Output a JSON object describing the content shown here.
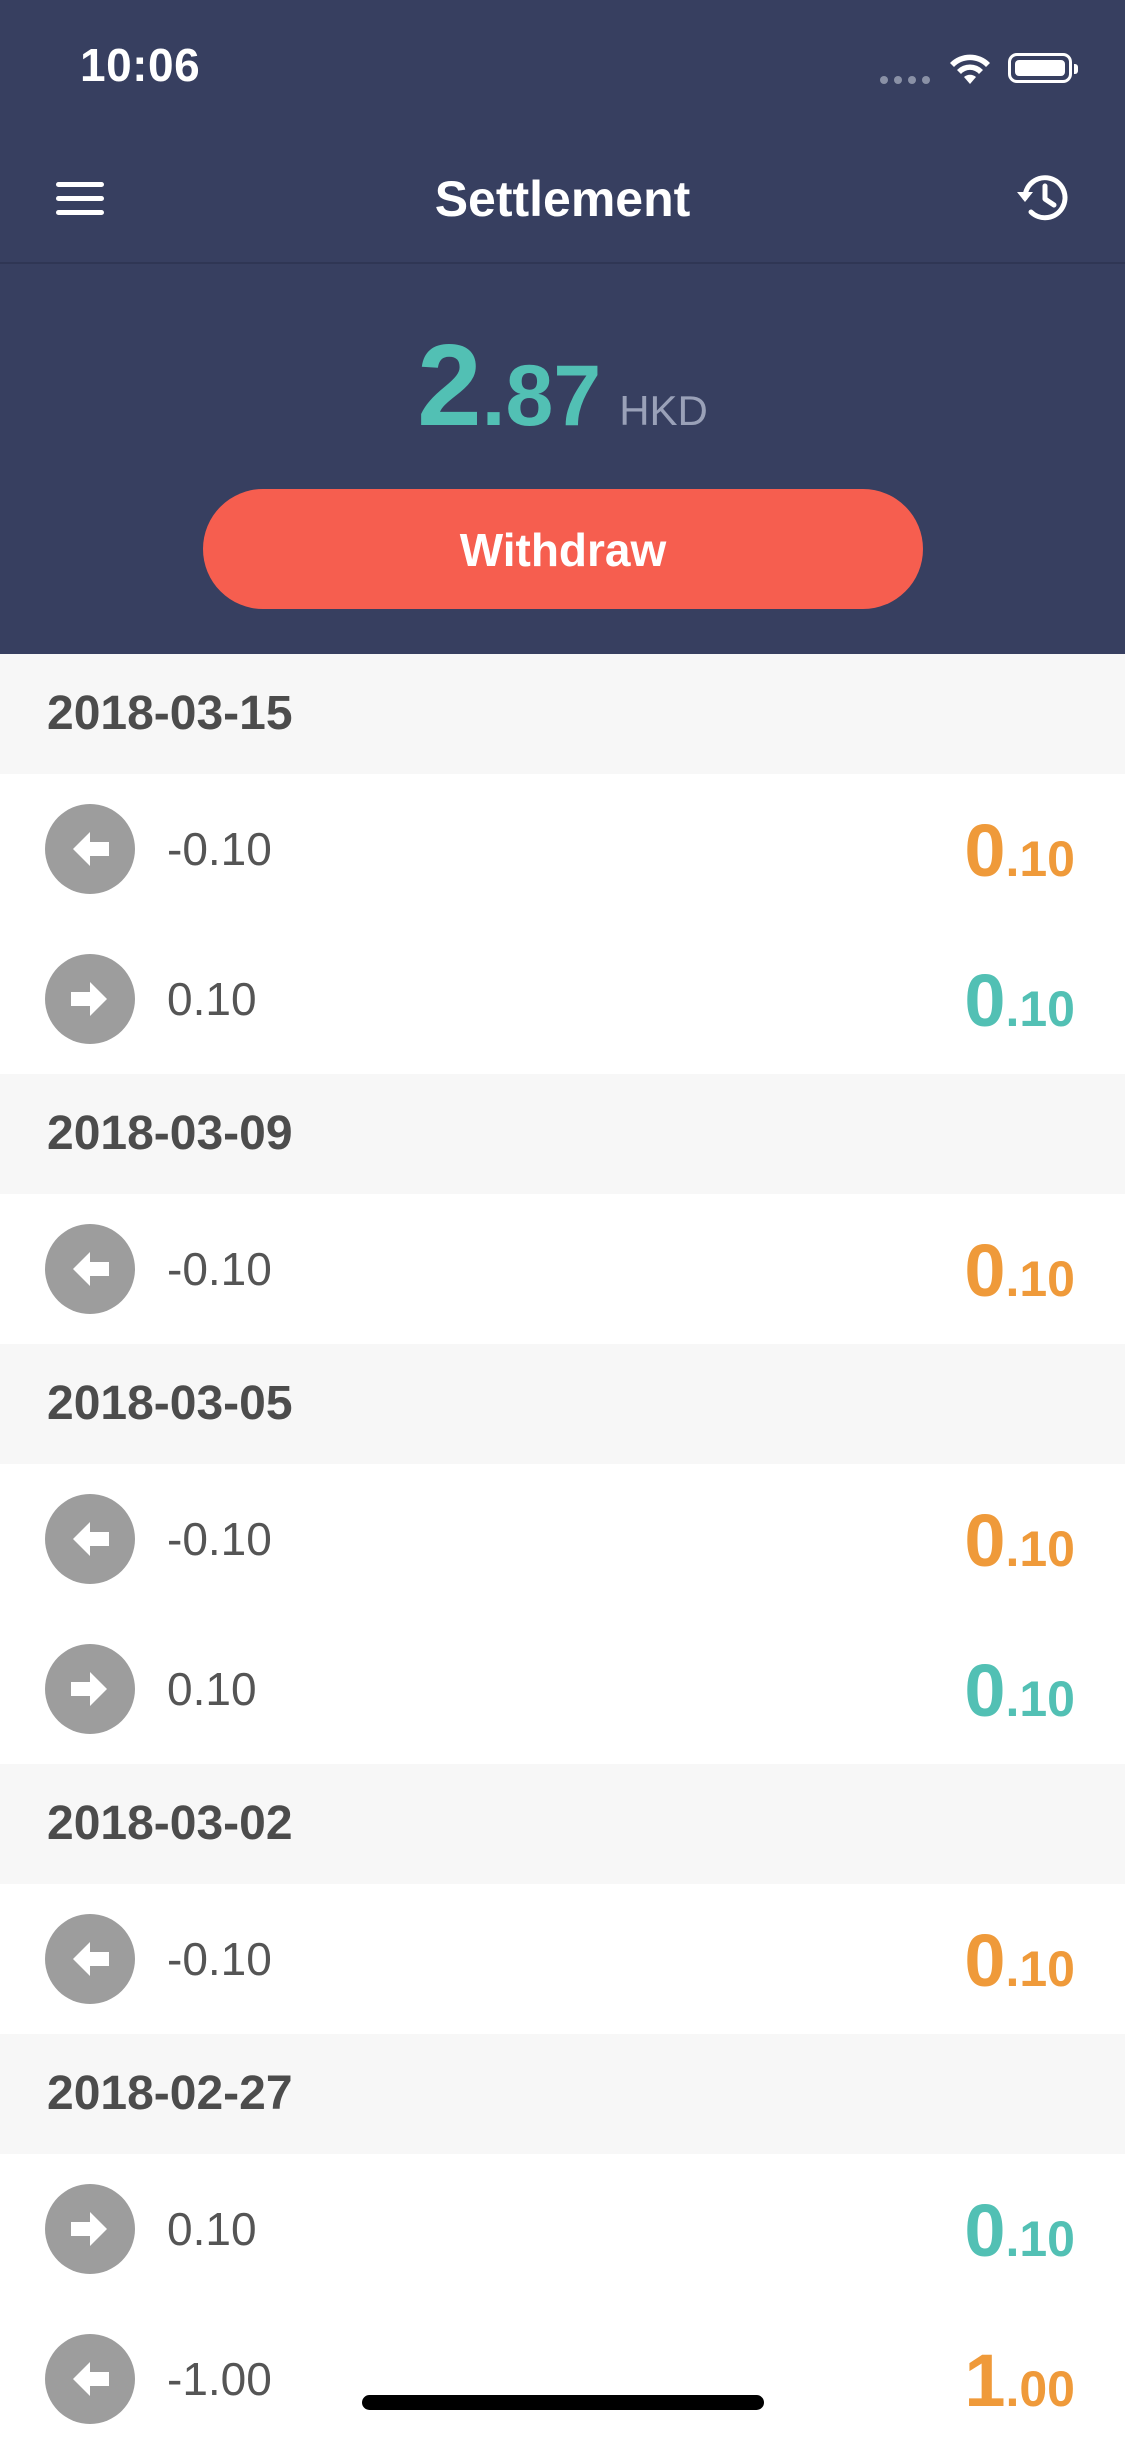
{
  "status_bar": {
    "time": "10:06"
  },
  "nav": {
    "title": "Settlement",
    "menu_icon": "hamburger-menu-icon",
    "history_icon": "history-clock-icon"
  },
  "balance": {
    "integer": "2",
    "decimal": ".87",
    "currency": "HKD"
  },
  "withdraw": {
    "label": "Withdraw"
  },
  "colors": {
    "header_bg": "#373f60",
    "accent_teal": "#52c0b4",
    "accent_orange": "#ef9a3a",
    "button_red": "#f65e4f"
  },
  "groups": [
    {
      "date": "2018-03-15",
      "transactions": [
        {
          "direction": "out",
          "label": "-0.10",
          "amount_int": "0",
          "amount_dec": ".10"
        },
        {
          "direction": "in",
          "label": "0.10",
          "amount_int": "0",
          "amount_dec": ".10"
        }
      ]
    },
    {
      "date": "2018-03-09",
      "transactions": [
        {
          "direction": "out",
          "label": "-0.10",
          "amount_int": "0",
          "amount_dec": ".10"
        }
      ]
    },
    {
      "date": "2018-03-05",
      "transactions": [
        {
          "direction": "out",
          "label": "-0.10",
          "amount_int": "0",
          "amount_dec": ".10"
        },
        {
          "direction": "in",
          "label": "0.10",
          "amount_int": "0",
          "amount_dec": ".10"
        }
      ]
    },
    {
      "date": "2018-03-02",
      "transactions": [
        {
          "direction": "out",
          "label": "-0.10",
          "amount_int": "0",
          "amount_dec": ".10"
        }
      ]
    },
    {
      "date": "2018-02-27",
      "transactions": [
        {
          "direction": "in",
          "label": "0.10",
          "amount_int": "0",
          "amount_dec": ".10"
        },
        {
          "direction": "out",
          "label": "-1.00",
          "amount_int": "1",
          "amount_dec": ".00"
        }
      ]
    }
  ]
}
